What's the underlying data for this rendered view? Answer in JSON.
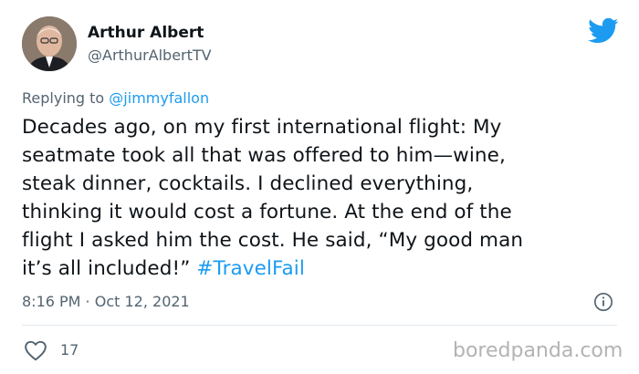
{
  "author": {
    "name": "Arthur Albert",
    "handle": "@ArthurAlbertTV",
    "avatar_icon": "avatar-photo"
  },
  "reply": {
    "prefix": "Replying to ",
    "mention": "@jimmyfallon"
  },
  "tweet": {
    "text": "Decades ago, on my first international flight: My\nseatmate took all that was offered to him—wine,\nsteak dinner, cocktails. I declined everything,\nthinking it would cost a fortune. At the end of the\nflight I asked him the cost. He said, “My good man\nit’s all included!” ",
    "hashtag": "#TravelFail"
  },
  "meta": {
    "timestamp": "8:16 PM · Oct 12, 2021"
  },
  "actions": {
    "likes": "17"
  },
  "watermark": "boredpanda.com",
  "colors": {
    "link": "#1d9bf0",
    "muted": "#536471",
    "text": "#0f1419"
  },
  "icons": [
    "twitter-bird-icon",
    "info-icon",
    "heart-icon"
  ]
}
